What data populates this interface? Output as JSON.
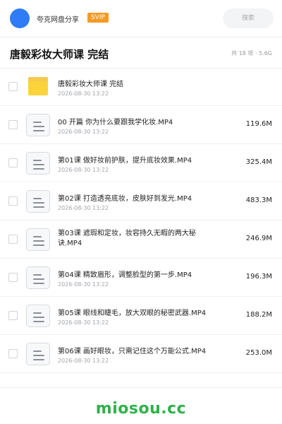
{
  "header": {
    "account_name": "夸克网盘分享",
    "badge": "SVIP",
    "search_placeholder": "搜索"
  },
  "folder": {
    "title": "唐毅彩妆大师课 完结",
    "meta": "共 18 项 · 5.6G"
  },
  "files": [
    {
      "name": "唐毅彩妆大师课 完结",
      "date": "2026-08-30 13:22",
      "size": "",
      "icon": "folder-icon"
    },
    {
      "name": "00 开篇 你为什么要跟我学化妆.MP4",
      "date": "2026-08-30 13:22",
      "size": "119.6M",
      "icon": "video-file-icon"
    },
    {
      "name": "第01课 做好妆前护肤，提升底妆效果.MP4",
      "date": "2026-08-30 13:22",
      "size": "325.4M",
      "icon": "video-file-icon"
    },
    {
      "name": "第02课 打造透亮底妆，皮肤好到发光.MP4",
      "date": "2026-08-30 13:22",
      "size": "483.3M",
      "icon": "video-file-icon"
    },
    {
      "name": "第03课 遮瑕和定妆，妆容持久无暇的两大秘诀.MP4",
      "date": "2026-08-30 13:22",
      "size": "246.9M",
      "icon": "video-file-icon"
    },
    {
      "name": "第04课 精致眉形，调整脸型的第一步.MP4",
      "date": "2026-08-30 13:22",
      "size": "196.3M",
      "icon": "video-file-icon"
    },
    {
      "name": "第05课 眼线和睫毛，放大双眼的秘密武器.MP4",
      "date": "2026-08-30 13:22",
      "size": "188.2M",
      "icon": "video-file-icon"
    },
    {
      "name": "第06课 画好眼妆，只需记住这个万能公式.MP4",
      "date": "2026-08-30 13:22",
      "size": "253.0M",
      "icon": "video-file-icon"
    }
  ],
  "watermark": "miosou.cc",
  "colors": {
    "accent": "#2f7cf6",
    "badge": "#f59a23",
    "folder": "#fbd33b",
    "watermark": "#2fb14a"
  }
}
